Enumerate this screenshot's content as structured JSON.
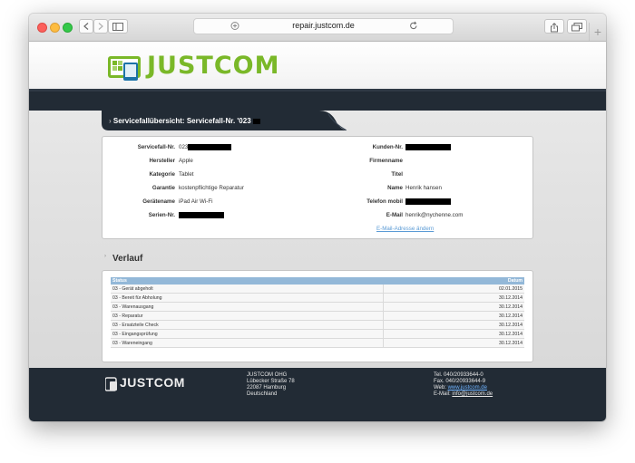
{
  "browser": {
    "url": "repair.justcom.de"
  },
  "header": {
    "brand": "JUSTCOM"
  },
  "service": {
    "tab_title": "Servicefallübersicht: Servicefall-Nr. '023",
    "left": [
      {
        "label": "Servicefall-Nr.",
        "value": "023"
      },
      {
        "label": "Hersteller",
        "value": "Apple"
      },
      {
        "label": "Kategorie",
        "value": "Tablet"
      },
      {
        "label": "Garantie",
        "value": "kostenpflichtige Reparatur"
      },
      {
        "label": "Gerätename",
        "value": "iPad Air Wi-Fi"
      },
      {
        "label": "Serien-Nr.",
        "value": ""
      }
    ],
    "right": [
      {
        "label": "Kunden-Nr.",
        "value": ""
      },
      {
        "label": "Firmenname",
        "value": ""
      },
      {
        "label": "Titel",
        "value": ""
      },
      {
        "label": "Name",
        "value": "Henrik hansen"
      },
      {
        "label": "Telefon mobil",
        "value": ""
      },
      {
        "label": "E-Mail",
        "value": "henrik@nychenne.com"
      }
    ],
    "email_change_link": "E-Mail-Adresse ändern"
  },
  "verlauf": {
    "title": "Verlauf",
    "columns": [
      "Status",
      "Datum"
    ],
    "rows": [
      [
        "03 - Gerät abgeholt",
        "02.01.2015"
      ],
      [
        "03 - Bereit für Abholung",
        "30.12.2014"
      ],
      [
        "03 - Warenausgang",
        "30.12.2014"
      ],
      [
        "03 - Reparatur",
        "30.12.2014"
      ],
      [
        "03 - Ersatzteile Check",
        "30.12.2014"
      ],
      [
        "03 - Eingangsprüfung",
        "30.12.2014"
      ],
      [
        "03 - Wareneingang",
        "30.12.2014"
      ]
    ]
  },
  "footer": {
    "brand": "JUSTCOM",
    "company": "JUSTCOM OHG",
    "street": "Lübecker Straße 78",
    "city": "22087 Hamburg",
    "country": "Deutschland",
    "tel": "Tel.  040/20933644-0",
    "fax": "Fax.  040/20933644-9",
    "web_label": "Web:",
    "web": "www.justcom.de",
    "email_label": "E-Mail:",
    "email": "info@justcom.de"
  },
  "colors": {
    "brand_green": "#7ab828",
    "navbar": "#222b35",
    "table_header": "#93b8d8",
    "link": "#5b9bd5"
  },
  "icons": [
    "back-icon",
    "forward-icon",
    "sidebar-icon",
    "shield-icon",
    "reload-icon",
    "share-icon",
    "tabs-icon",
    "new-tab-icon",
    "logo-icon"
  ]
}
